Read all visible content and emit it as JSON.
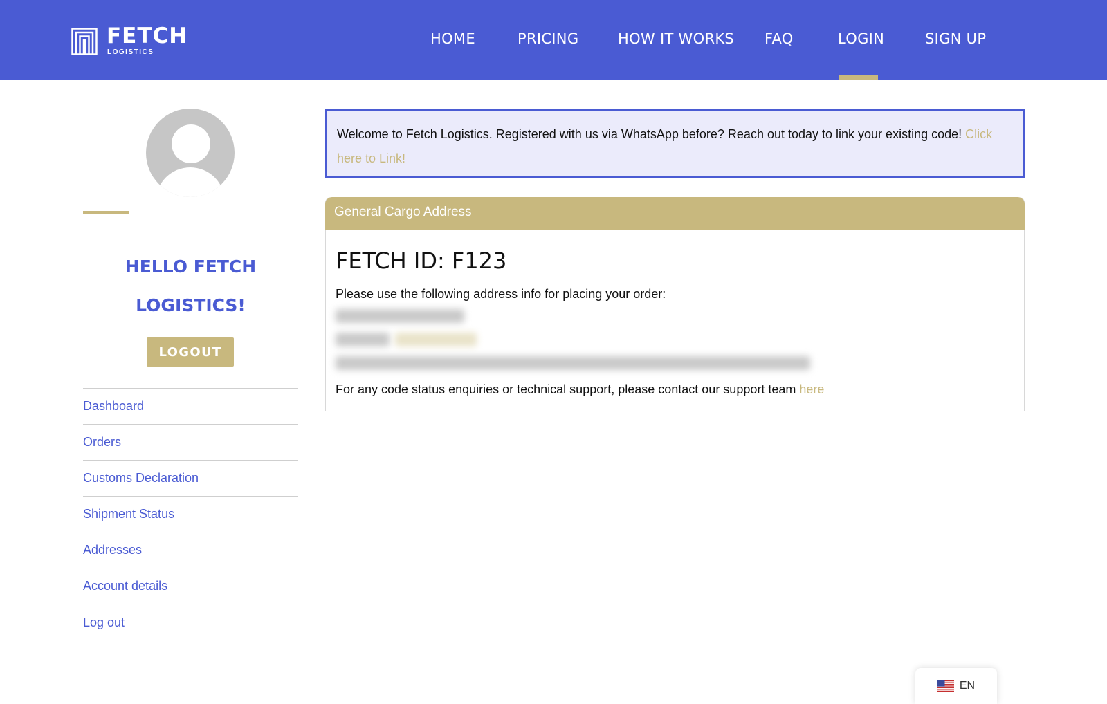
{
  "header": {
    "logo_name": "FETCH",
    "logo_sub": "LOGISTICS",
    "nav": [
      {
        "label": "HOME"
      },
      {
        "label": "PRICING"
      },
      {
        "label": "HOW IT WORKS"
      },
      {
        "label": "FAQ"
      },
      {
        "label": "LOGIN",
        "active": true
      },
      {
        "label": "SIGN UP"
      }
    ]
  },
  "sidebar": {
    "greeting": "HELLO FETCH LOGISTICS!",
    "logout_label": "LOGOUT",
    "menu": [
      {
        "label": "Dashboard"
      },
      {
        "label": "Orders"
      },
      {
        "label": "Customs Declaration"
      },
      {
        "label": "Shipment Status"
      },
      {
        "label": "Addresses"
      },
      {
        "label": "Account details"
      },
      {
        "label": "Log out"
      }
    ]
  },
  "notice": {
    "text": "Welcome to Fetch Logistics. Registered with us via WhatsApp before? Reach out today to link your existing code! ",
    "link_label": "Click here to Link!"
  },
  "card": {
    "title": "General Cargo Address",
    "fetch_id": "FETCH ID: F123",
    "instructions": "Please use the following address info for placing your order:",
    "support_text": "For any code status enquiries or technical support, please contact our support team ",
    "support_link": "here"
  },
  "language": {
    "label": "EN",
    "flag_icon": "us-flag-icon"
  },
  "colors": {
    "brand_blue": "#4a5bd3",
    "accent_gold": "#c8b87e",
    "notice_bg": "#ebebfb"
  }
}
